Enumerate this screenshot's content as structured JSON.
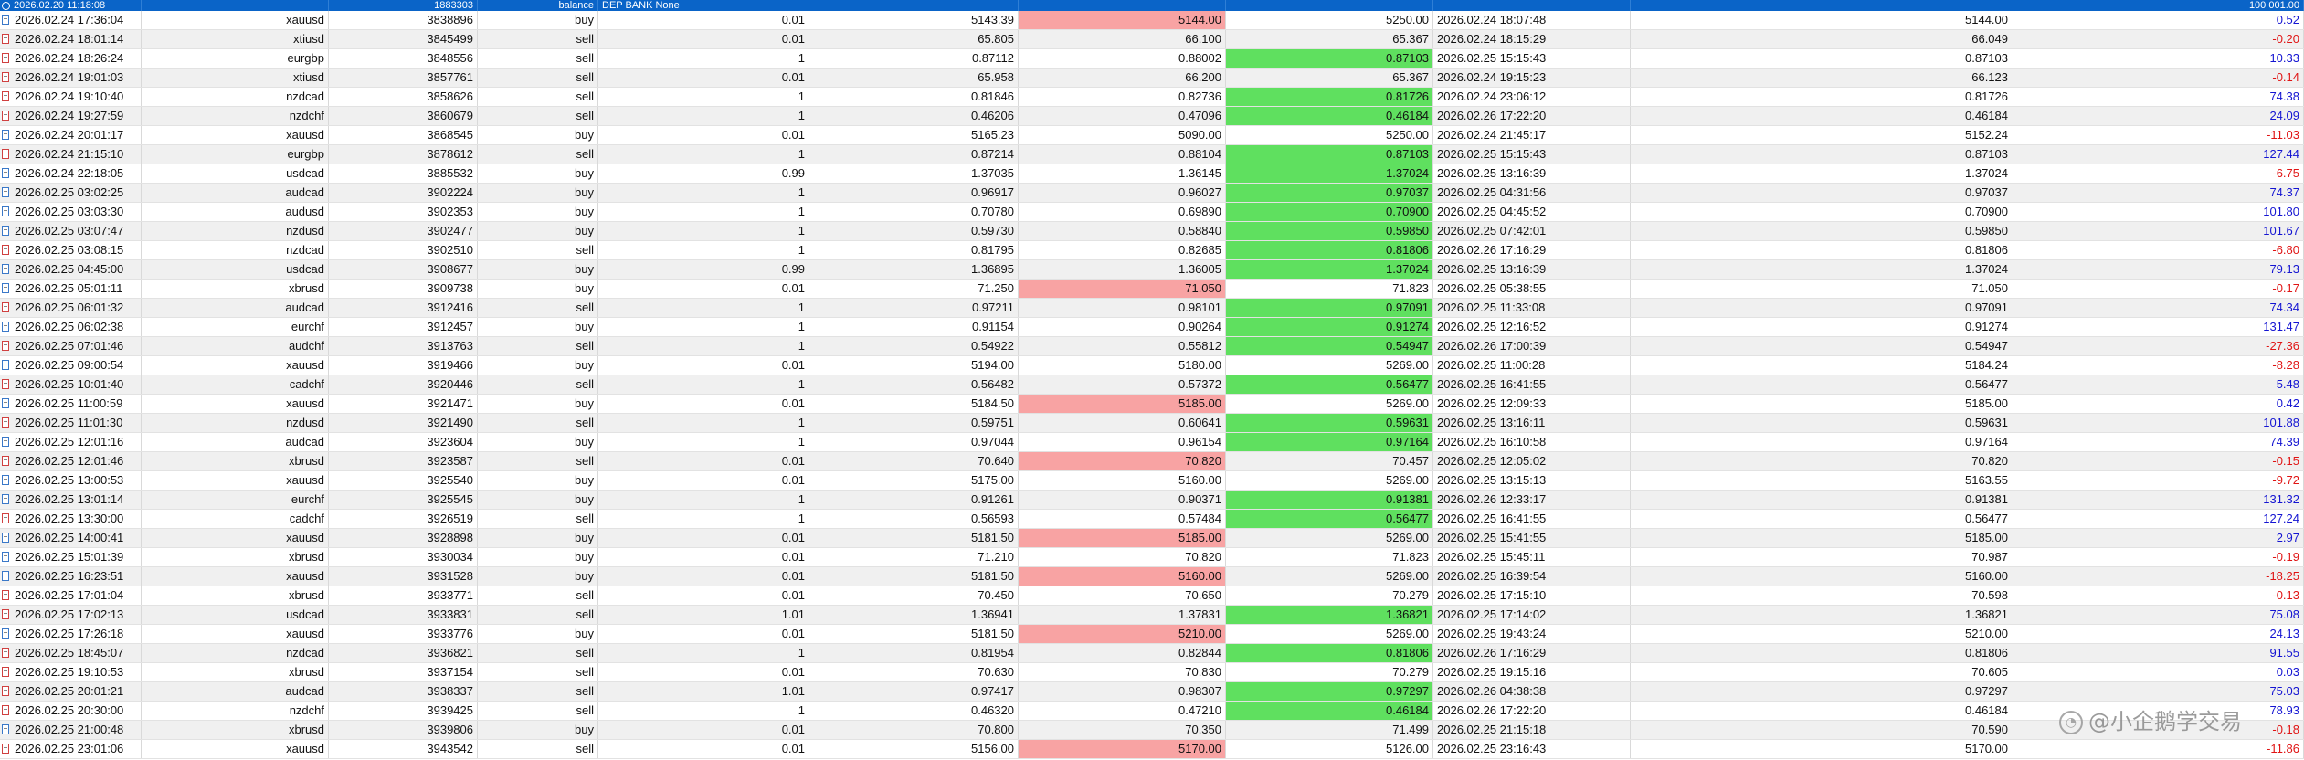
{
  "header_row": {
    "time": "2026.02.20 11:18:08",
    "ticket": "1883303",
    "type": "balance",
    "comment": "DEP BANK None",
    "amount": "100 001.00"
  },
  "colors": {
    "header_bg": "#0a64c8",
    "loss_cell": "#f8a3a3",
    "profit_cell": "#5fe05f",
    "positive_text": "#1414d2",
    "negative_text": "#e01414"
  },
  "rows": [
    {
      "open_time": "2026.02.24 17:36:04",
      "symbol": "xauusd",
      "ticket": "3838896",
      "type": "buy",
      "volume": "0.01",
      "open_price": "5143.39",
      "sl": "5144.00",
      "sl_hl": "red",
      "tp": "5250.00",
      "tp_hl": "",
      "close_time": "2026.02.24 18:07:48",
      "close_price": "5144.00",
      "profit": "0.52"
    },
    {
      "open_time": "2026.02.24 18:01:14",
      "symbol": "xtiusd",
      "ticket": "3845499",
      "type": "sell",
      "volume": "0.01",
      "open_price": "65.805",
      "sl": "66.100",
      "sl_hl": "",
      "tp": "65.367",
      "tp_hl": "",
      "close_time": "2026.02.24 18:15:29",
      "close_price": "66.049",
      "profit": "-0.20"
    },
    {
      "open_time": "2026.02.24 18:26:24",
      "symbol": "eurgbp",
      "ticket": "3848556",
      "type": "sell",
      "volume": "1",
      "open_price": "0.87112",
      "sl": "0.88002",
      "sl_hl": "",
      "tp": "0.87103",
      "tp_hl": "green",
      "close_time": "2026.02.25 15:15:43",
      "close_price": "0.87103",
      "profit": "10.33"
    },
    {
      "open_time": "2026.02.24 19:01:03",
      "symbol": "xtiusd",
      "ticket": "3857761",
      "type": "sell",
      "volume": "0.01",
      "open_price": "65.958",
      "sl": "66.200",
      "sl_hl": "",
      "tp": "65.367",
      "tp_hl": "",
      "close_time": "2026.02.24 19:15:23",
      "close_price": "66.123",
      "profit": "-0.14"
    },
    {
      "open_time": "2026.02.24 19:10:40",
      "symbol": "nzdcad",
      "ticket": "3858626",
      "type": "sell",
      "volume": "1",
      "open_price": "0.81846",
      "sl": "0.82736",
      "sl_hl": "",
      "tp": "0.81726",
      "tp_hl": "green",
      "close_time": "2026.02.24 23:06:12",
      "close_price": "0.81726",
      "profit": "74.38"
    },
    {
      "open_time": "2026.02.24 19:27:59",
      "symbol": "nzdchf",
      "ticket": "3860679",
      "type": "sell",
      "volume": "1",
      "open_price": "0.46206",
      "sl": "0.47096",
      "sl_hl": "",
      "tp": "0.46184",
      "tp_hl": "green",
      "close_time": "2026.02.26 17:22:20",
      "close_price": "0.46184",
      "profit": "24.09"
    },
    {
      "open_time": "2026.02.24 20:01:17",
      "symbol": "xauusd",
      "ticket": "3868545",
      "type": "buy",
      "volume": "0.01",
      "open_price": "5165.23",
      "sl": "5090.00",
      "sl_hl": "",
      "tp": "5250.00",
      "tp_hl": "",
      "close_time": "2026.02.24 21:45:17",
      "close_price": "5152.24",
      "profit": "-11.03"
    },
    {
      "open_time": "2026.02.24 21:15:10",
      "symbol": "eurgbp",
      "ticket": "3878612",
      "type": "sell",
      "volume": "1",
      "open_price": "0.87214",
      "sl": "0.88104",
      "sl_hl": "",
      "tp": "0.87103",
      "tp_hl": "green",
      "close_time": "2026.02.25 15:15:43",
      "close_price": "0.87103",
      "profit": "127.44"
    },
    {
      "open_time": "2026.02.24 22:18:05",
      "symbol": "usdcad",
      "ticket": "3885532",
      "type": "buy",
      "volume": "0.99",
      "open_price": "1.37035",
      "sl": "1.36145",
      "sl_hl": "",
      "tp": "1.37024",
      "tp_hl": "green",
      "close_time": "2026.02.25 13:16:39",
      "close_price": "1.37024",
      "profit": "-6.75"
    },
    {
      "open_time": "2026.02.25 03:02:25",
      "symbol": "audcad",
      "ticket": "3902224",
      "type": "buy",
      "volume": "1",
      "open_price": "0.96917",
      "sl": "0.96027",
      "sl_hl": "",
      "tp": "0.97037",
      "tp_hl": "green",
      "close_time": "2026.02.25 04:31:56",
      "close_price": "0.97037",
      "profit": "74.37"
    },
    {
      "open_time": "2026.02.25 03:03:30",
      "symbol": "audusd",
      "ticket": "3902353",
      "type": "buy",
      "volume": "1",
      "open_price": "0.70780",
      "sl": "0.69890",
      "sl_hl": "",
      "tp": "0.70900",
      "tp_hl": "green",
      "close_time": "2026.02.25 04:45:52",
      "close_price": "0.70900",
      "profit": "101.80"
    },
    {
      "open_time": "2026.02.25 03:07:47",
      "symbol": "nzdusd",
      "ticket": "3902477",
      "type": "buy",
      "volume": "1",
      "open_price": "0.59730",
      "sl": "0.58840",
      "sl_hl": "",
      "tp": "0.59850",
      "tp_hl": "green",
      "close_time": "2026.02.25 07:42:01",
      "close_price": "0.59850",
      "profit": "101.67"
    },
    {
      "open_time": "2026.02.25 03:08:15",
      "symbol": "nzdcad",
      "ticket": "3902510",
      "type": "sell",
      "volume": "1",
      "open_price": "0.81795",
      "sl": "0.82685",
      "sl_hl": "",
      "tp": "0.81806",
      "tp_hl": "green",
      "close_time": "2026.02.26 17:16:29",
      "close_price": "0.81806",
      "profit": "-6.80"
    },
    {
      "open_time": "2026.02.25 04:45:00",
      "symbol": "usdcad",
      "ticket": "3908677",
      "type": "buy",
      "volume": "0.99",
      "open_price": "1.36895",
      "sl": "1.36005",
      "sl_hl": "",
      "tp": "1.37024",
      "tp_hl": "green",
      "close_time": "2026.02.25 13:16:39",
      "close_price": "1.37024",
      "profit": "79.13"
    },
    {
      "open_time": "2026.02.25 05:01:11",
      "symbol": "xbrusd",
      "ticket": "3909738",
      "type": "buy",
      "volume": "0.01",
      "open_price": "71.250",
      "sl": "71.050",
      "sl_hl": "red",
      "tp": "71.823",
      "tp_hl": "",
      "close_time": "2026.02.25 05:38:55",
      "close_price": "71.050",
      "profit": "-0.17"
    },
    {
      "open_time": "2026.02.25 06:01:32",
      "symbol": "audcad",
      "ticket": "3912416",
      "type": "sell",
      "volume": "1",
      "open_price": "0.97211",
      "sl": "0.98101",
      "sl_hl": "",
      "tp": "0.97091",
      "tp_hl": "green",
      "close_time": "2026.02.25 11:33:08",
      "close_price": "0.97091",
      "profit": "74.34"
    },
    {
      "open_time": "2026.02.25 06:02:38",
      "symbol": "eurchf",
      "ticket": "3912457",
      "type": "buy",
      "volume": "1",
      "open_price": "0.91154",
      "sl": "0.90264",
      "sl_hl": "",
      "tp": "0.91274",
      "tp_hl": "green",
      "close_time": "2026.02.25 12:16:52",
      "close_price": "0.91274",
      "profit": "131.47"
    },
    {
      "open_time": "2026.02.25 07:01:46",
      "symbol": "audchf",
      "ticket": "3913763",
      "type": "sell",
      "volume": "1",
      "open_price": "0.54922",
      "sl": "0.55812",
      "sl_hl": "",
      "tp": "0.54947",
      "tp_hl": "green",
      "close_time": "2026.02.26 17:00:39",
      "close_price": "0.54947",
      "profit": "-27.36"
    },
    {
      "open_time": "2026.02.25 09:00:54",
      "symbol": "xauusd",
      "ticket": "3919466",
      "type": "buy",
      "volume": "0.01",
      "open_price": "5194.00",
      "sl": "5180.00",
      "sl_hl": "",
      "tp": "5269.00",
      "tp_hl": "",
      "close_time": "2026.02.25 11:00:28",
      "close_price": "5184.24",
      "profit": "-8.28"
    },
    {
      "open_time": "2026.02.25 10:01:40",
      "symbol": "cadchf",
      "ticket": "3920446",
      "type": "sell",
      "volume": "1",
      "open_price": "0.56482",
      "sl": "0.57372",
      "sl_hl": "",
      "tp": "0.56477",
      "tp_hl": "green",
      "close_time": "2026.02.25 16:41:55",
      "close_price": "0.56477",
      "profit": "5.48"
    },
    {
      "open_time": "2026.02.25 11:00:59",
      "symbol": "xauusd",
      "ticket": "3921471",
      "type": "buy",
      "volume": "0.01",
      "open_price": "5184.50",
      "sl": "5185.00",
      "sl_hl": "red",
      "tp": "5269.00",
      "tp_hl": "",
      "close_time": "2026.02.25 12:09:33",
      "close_price": "5185.00",
      "profit": "0.42"
    },
    {
      "open_time": "2026.02.25 11:01:30",
      "symbol": "nzdusd",
      "ticket": "3921490",
      "type": "sell",
      "volume": "1",
      "open_price": "0.59751",
      "sl": "0.60641",
      "sl_hl": "",
      "tp": "0.59631",
      "tp_hl": "green",
      "close_time": "2026.02.25 13:16:11",
      "close_price": "0.59631",
      "profit": "101.88"
    },
    {
      "open_time": "2026.02.25 12:01:16",
      "symbol": "audcad",
      "ticket": "3923604",
      "type": "buy",
      "volume": "1",
      "open_price": "0.97044",
      "sl": "0.96154",
      "sl_hl": "",
      "tp": "0.97164",
      "tp_hl": "green",
      "close_time": "2026.02.25 16:10:58",
      "close_price": "0.97164",
      "profit": "74.39"
    },
    {
      "open_time": "2026.02.25 12:01:46",
      "symbol": "xbrusd",
      "ticket": "3923587",
      "type": "sell",
      "volume": "0.01",
      "open_price": "70.640",
      "sl": "70.820",
      "sl_hl": "red",
      "tp": "70.457",
      "tp_hl": "",
      "close_time": "2026.02.25 12:05:02",
      "close_price": "70.820",
      "profit": "-0.15"
    },
    {
      "open_time": "2026.02.25 13:00:53",
      "symbol": "xauusd",
      "ticket": "3925540",
      "type": "buy",
      "volume": "0.01",
      "open_price": "5175.00",
      "sl": "5160.00",
      "sl_hl": "",
      "tp": "5269.00",
      "tp_hl": "",
      "close_time": "2026.02.25 13:15:13",
      "close_price": "5163.55",
      "profit": "-9.72"
    },
    {
      "open_time": "2026.02.25 13:01:14",
      "symbol": "eurchf",
      "ticket": "3925545",
      "type": "buy",
      "volume": "1",
      "open_price": "0.91261",
      "sl": "0.90371",
      "sl_hl": "",
      "tp": "0.91381",
      "tp_hl": "green",
      "close_time": "2026.02.26 12:33:17",
      "close_price": "0.91381",
      "profit": "131.32"
    },
    {
      "open_time": "2026.02.25 13:30:00",
      "symbol": "cadchf",
      "ticket": "3926519",
      "type": "sell",
      "volume": "1",
      "open_price": "0.56593",
      "sl": "0.57484",
      "sl_hl": "",
      "tp": "0.56477",
      "tp_hl": "green",
      "close_time": "2026.02.25 16:41:55",
      "close_price": "0.56477",
      "profit": "127.24"
    },
    {
      "open_time": "2026.02.25 14:00:41",
      "symbol": "xauusd",
      "ticket": "3928898",
      "type": "buy",
      "volume": "0.01",
      "open_price": "5181.50",
      "sl": "5185.00",
      "sl_hl": "red",
      "tp": "5269.00",
      "tp_hl": "",
      "close_time": "2026.02.25 15:41:55",
      "close_price": "5185.00",
      "profit": "2.97"
    },
    {
      "open_time": "2026.02.25 15:01:39",
      "symbol": "xbrusd",
      "ticket": "3930034",
      "type": "buy",
      "volume": "0.01",
      "open_price": "71.210",
      "sl": "70.820",
      "sl_hl": "",
      "tp": "71.823",
      "tp_hl": "",
      "close_time": "2026.02.25 15:45:11",
      "close_price": "70.987",
      "profit": "-0.19"
    },
    {
      "open_time": "2026.02.25 16:23:51",
      "symbol": "xauusd",
      "ticket": "3931528",
      "type": "buy",
      "volume": "0.01",
      "open_price": "5181.50",
      "sl": "5160.00",
      "sl_hl": "red",
      "tp": "5269.00",
      "tp_hl": "",
      "close_time": "2026.02.25 16:39:54",
      "close_price": "5160.00",
      "profit": "-18.25"
    },
    {
      "open_time": "2026.02.25 17:01:04",
      "symbol": "xbrusd",
      "ticket": "3933771",
      "type": "sell",
      "volume": "0.01",
      "open_price": "70.450",
      "sl": "70.650",
      "sl_hl": "",
      "tp": "70.279",
      "tp_hl": "",
      "close_time": "2026.02.25 17:15:10",
      "close_price": "70.598",
      "profit": "-0.13"
    },
    {
      "open_time": "2026.02.25 17:02:13",
      "symbol": "usdcad",
      "ticket": "3933831",
      "type": "sell",
      "volume": "1.01",
      "open_price": "1.36941",
      "sl": "1.37831",
      "sl_hl": "",
      "tp": "1.36821",
      "tp_hl": "green",
      "close_time": "2026.02.25 17:14:02",
      "close_price": "1.36821",
      "profit": "75.08"
    },
    {
      "open_time": "2026.02.25 17:26:18",
      "symbol": "xauusd",
      "ticket": "3933776",
      "type": "buy",
      "volume": "0.01",
      "open_price": "5181.50",
      "sl": "5210.00",
      "sl_hl": "red",
      "tp": "5269.00",
      "tp_hl": "",
      "close_time": "2026.02.25 19:43:24",
      "close_price": "5210.00",
      "profit": "24.13"
    },
    {
      "open_time": "2026.02.25 18:45:07",
      "symbol": "nzdcad",
      "ticket": "3936821",
      "type": "sell",
      "volume": "1",
      "open_price": "0.81954",
      "sl": "0.82844",
      "sl_hl": "",
      "tp": "0.81806",
      "tp_hl": "green",
      "close_time": "2026.02.26 17:16:29",
      "close_price": "0.81806",
      "profit": "91.55"
    },
    {
      "open_time": "2026.02.25 19:10:53",
      "symbol": "xbrusd",
      "ticket": "3937154",
      "type": "sell",
      "volume": "0.01",
      "open_price": "70.630",
      "sl": "70.830",
      "sl_hl": "",
      "tp": "70.279",
      "tp_hl": "",
      "close_time": "2026.02.25 19:15:16",
      "close_price": "70.605",
      "profit": "0.03"
    },
    {
      "open_time": "2026.02.25 20:01:21",
      "symbol": "audcad",
      "ticket": "3938337",
      "type": "sell",
      "volume": "1.01",
      "open_price": "0.97417",
      "sl": "0.98307",
      "sl_hl": "",
      "tp": "0.97297",
      "tp_hl": "green",
      "close_time": "2026.02.26 04:38:38",
      "close_price": "0.97297",
      "profit": "75.03"
    },
    {
      "open_time": "2026.02.25 20:30:00",
      "symbol": "nzdchf",
      "ticket": "3939425",
      "type": "sell",
      "volume": "1",
      "open_price": "0.46320",
      "sl": "0.47210",
      "sl_hl": "",
      "tp": "0.46184",
      "tp_hl": "green",
      "close_time": "2026.02.26 17:22:20",
      "close_price": "0.46184",
      "profit": "78.93"
    },
    {
      "open_time": "2026.02.25 21:00:48",
      "symbol": "xbrusd",
      "ticket": "3939806",
      "type": "buy",
      "volume": "0.01",
      "open_price": "70.800",
      "sl": "70.350",
      "sl_hl": "",
      "tp": "71.499",
      "tp_hl": "",
      "close_time": "2026.02.25 21:15:18",
      "close_price": "70.590",
      "profit": "-0.18"
    },
    {
      "open_time": "2026.02.25 23:01:06",
      "symbol": "xauusd",
      "ticket": "3943542",
      "type": "sell",
      "volume": "0.01",
      "open_price": "5156.00",
      "sl": "5170.00",
      "sl_hl": "red",
      "tp": "5126.00",
      "tp_hl": "",
      "close_time": "2026.02.25 23:16:43",
      "close_price": "5170.00",
      "profit": "-11.86"
    }
  ],
  "watermark": {
    "icon": "wechat-logo-icon",
    "text": "@小企鹅学交易"
  }
}
